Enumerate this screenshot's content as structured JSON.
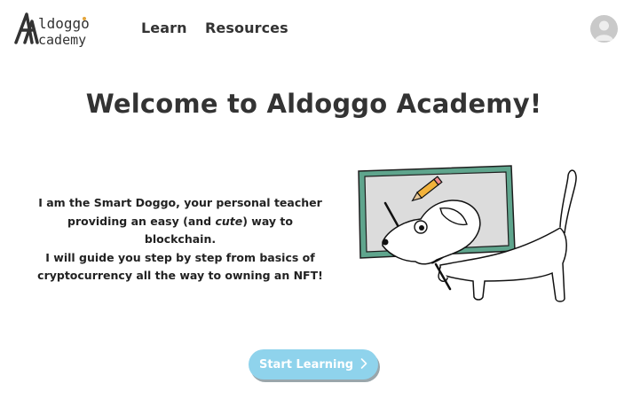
{
  "nav": {
    "logo_line1": "ldoggo",
    "logo_line2": "cademy",
    "learn": "Learn",
    "resources": "Resources"
  },
  "main": {
    "title": "Welcome to Aldoggo Academy!",
    "intro_a": "I am the Smart Doggo, your personal teacher",
    "intro_b1": "providing an easy (and ",
    "intro_b_em": "cute",
    "intro_b2": ") way to blockchain.",
    "intro_c": "I will guide you step by step from basics of",
    "intro_d": "cryptocurrency all the way to owning an NFT!"
  },
  "cta": {
    "label": "Start Learning",
    "icon": "chevron-right-icon",
    "color": "#8fd3ec"
  },
  "icons": {
    "avatar": "user-avatar-icon",
    "illustration": "dog-at-chalkboard"
  }
}
